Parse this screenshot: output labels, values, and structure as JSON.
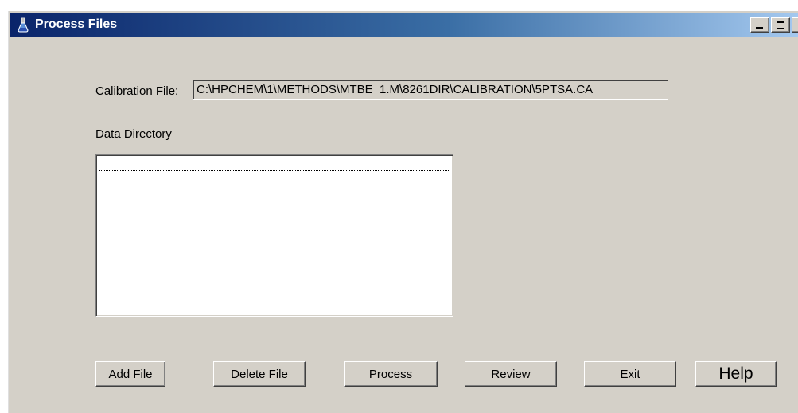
{
  "window": {
    "title": "Process Files",
    "icon": "flask-icon",
    "controls": {
      "minimize": "minimize-icon",
      "maximize": "maximize-icon",
      "close_glyph": "×"
    }
  },
  "form": {
    "calibration_label": "Calibration File:",
    "calibration_value": "C:\\HPCHEM\\1\\METHODS\\MTBE_1.M\\8261DIR\\CALIBRATION\\5PTSA.CA",
    "data_directory_label": "Data Directory",
    "data_directory_items": []
  },
  "buttons": {
    "add_file": "Add File",
    "delete_file": "Delete File",
    "process": "Process",
    "review": "Review",
    "exit": "Exit",
    "help": "Help"
  },
  "colors": {
    "titlebar_start": "#0a246a",
    "titlebar_end": "#a6caf0",
    "face": "#d4d0c8"
  }
}
